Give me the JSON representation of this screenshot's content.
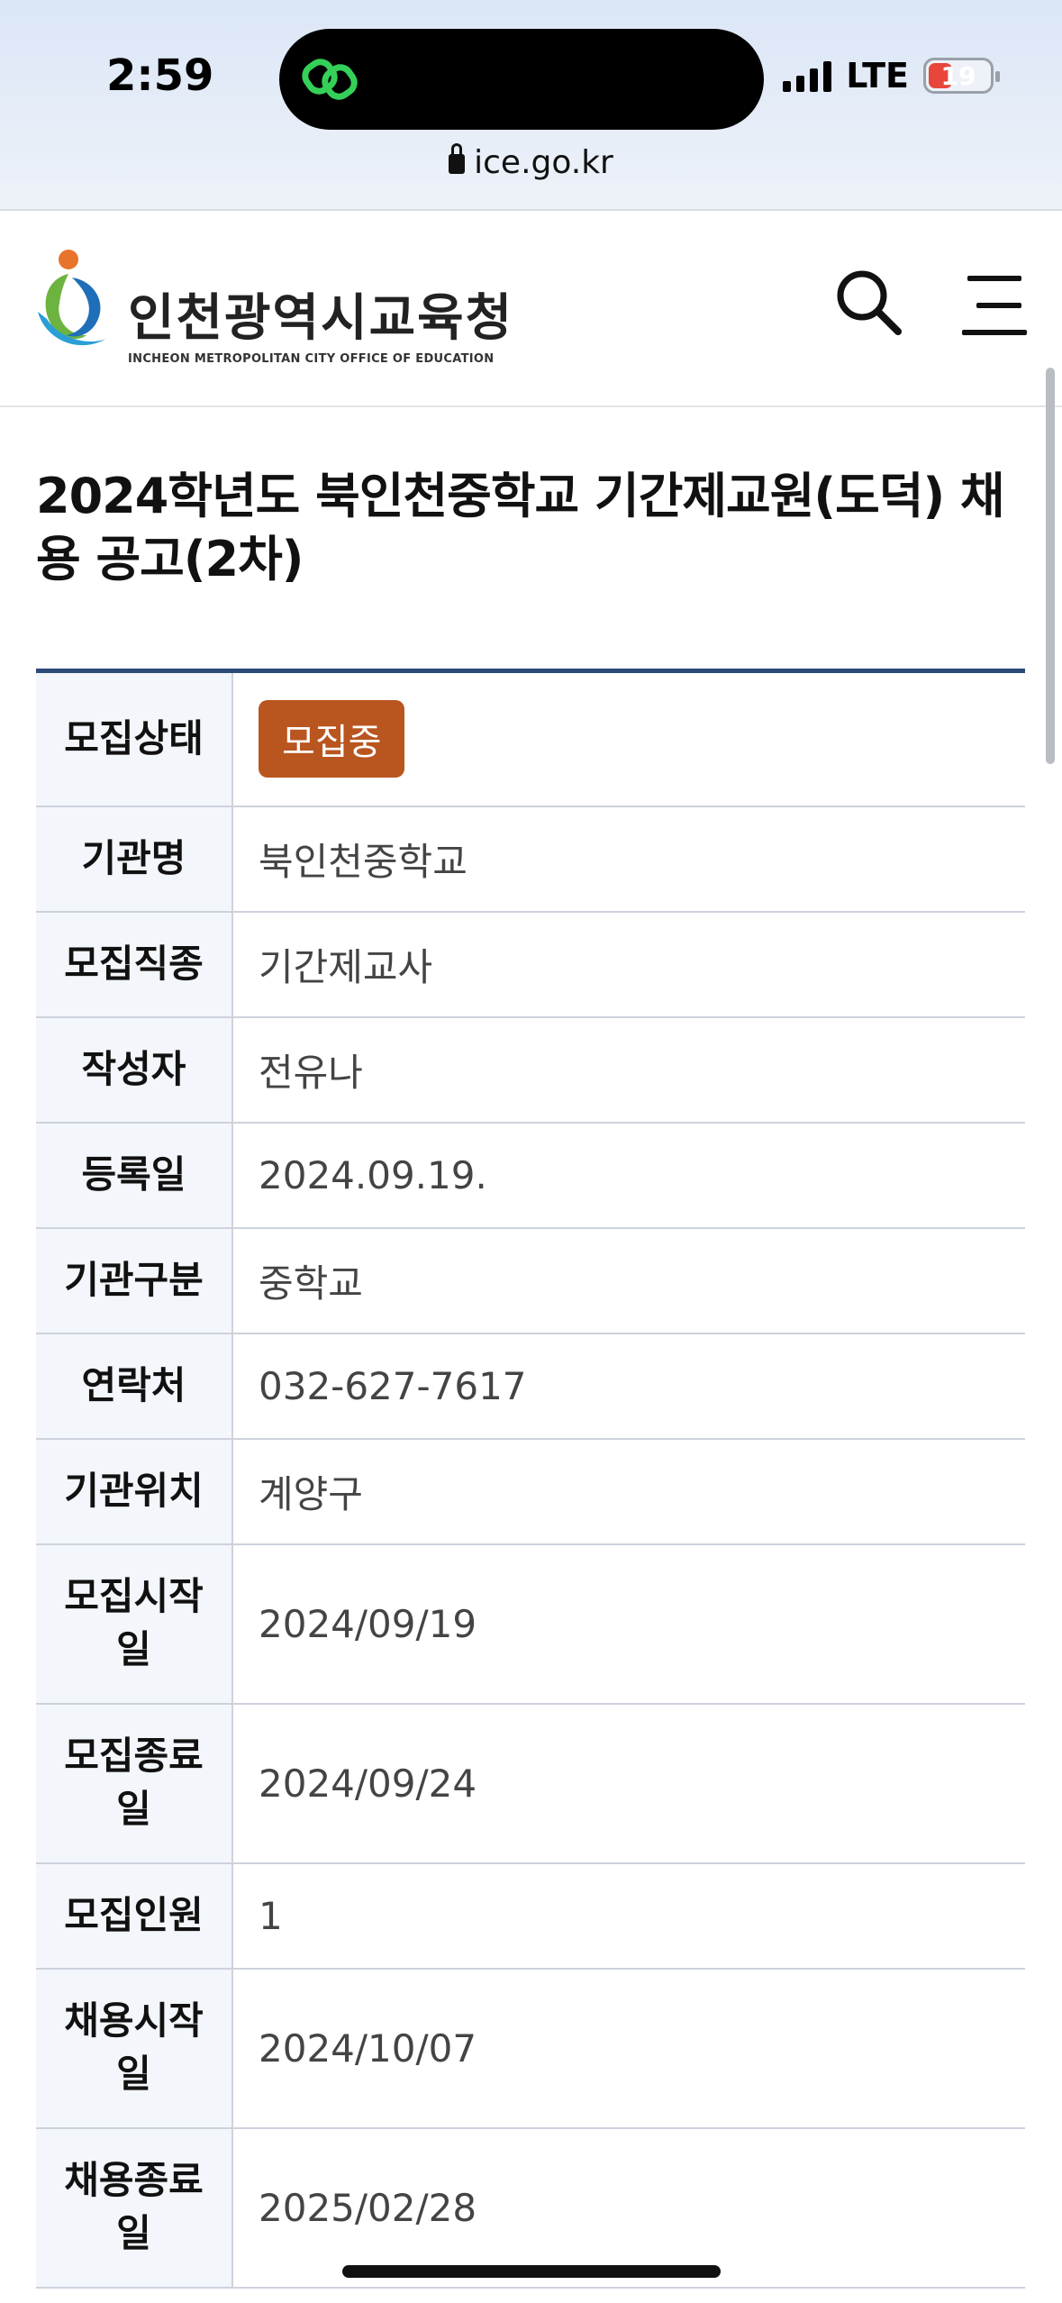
{
  "status_bar": {
    "time": "2:59",
    "network": "LTE",
    "battery": "19",
    "battery_level_percent": 19,
    "battery_color": "#e8463b"
  },
  "browser": {
    "url": "ice.go.kr"
  },
  "site": {
    "logo_kr": "인천광역시교육청",
    "logo_en": "INCHEON METROPOLITAN CITY OFFICE OF EDUCATION",
    "accent_color": "#2d4a78"
  },
  "icons": {
    "search": "search-icon",
    "menu": "hamburger-menu-icon",
    "lock": "lock-icon",
    "link": "link-icon"
  },
  "post": {
    "title": "2024학년도 북인천중학교 기간제교원(도덕) 채용 공고(2차)"
  },
  "details": {
    "status": {
      "label": "모집상태",
      "value": "모집중",
      "badge_color": "#b9551f"
    },
    "rows": [
      {
        "label": "기관명",
        "value": "북인천중학교"
      },
      {
        "label": "모집직종",
        "value": "기간제교사"
      },
      {
        "label": "작성자",
        "value": "전유나"
      },
      {
        "label": "등록일",
        "value": "2024.09.19."
      },
      {
        "label": "기관구분",
        "value": "중학교"
      },
      {
        "label": "연락처",
        "value": "032-627-7617"
      },
      {
        "label": "기관위치",
        "value": "계양구"
      },
      {
        "label": "모집시작일",
        "value": "2024/09/19"
      },
      {
        "label": "모집종료일",
        "value": "2024/09/24"
      },
      {
        "label": "모집인원",
        "value": "1"
      },
      {
        "label": "채용시작일",
        "value": "2024/10/07"
      },
      {
        "label": "채용종료일",
        "value": "2025/02/28"
      }
    ]
  }
}
